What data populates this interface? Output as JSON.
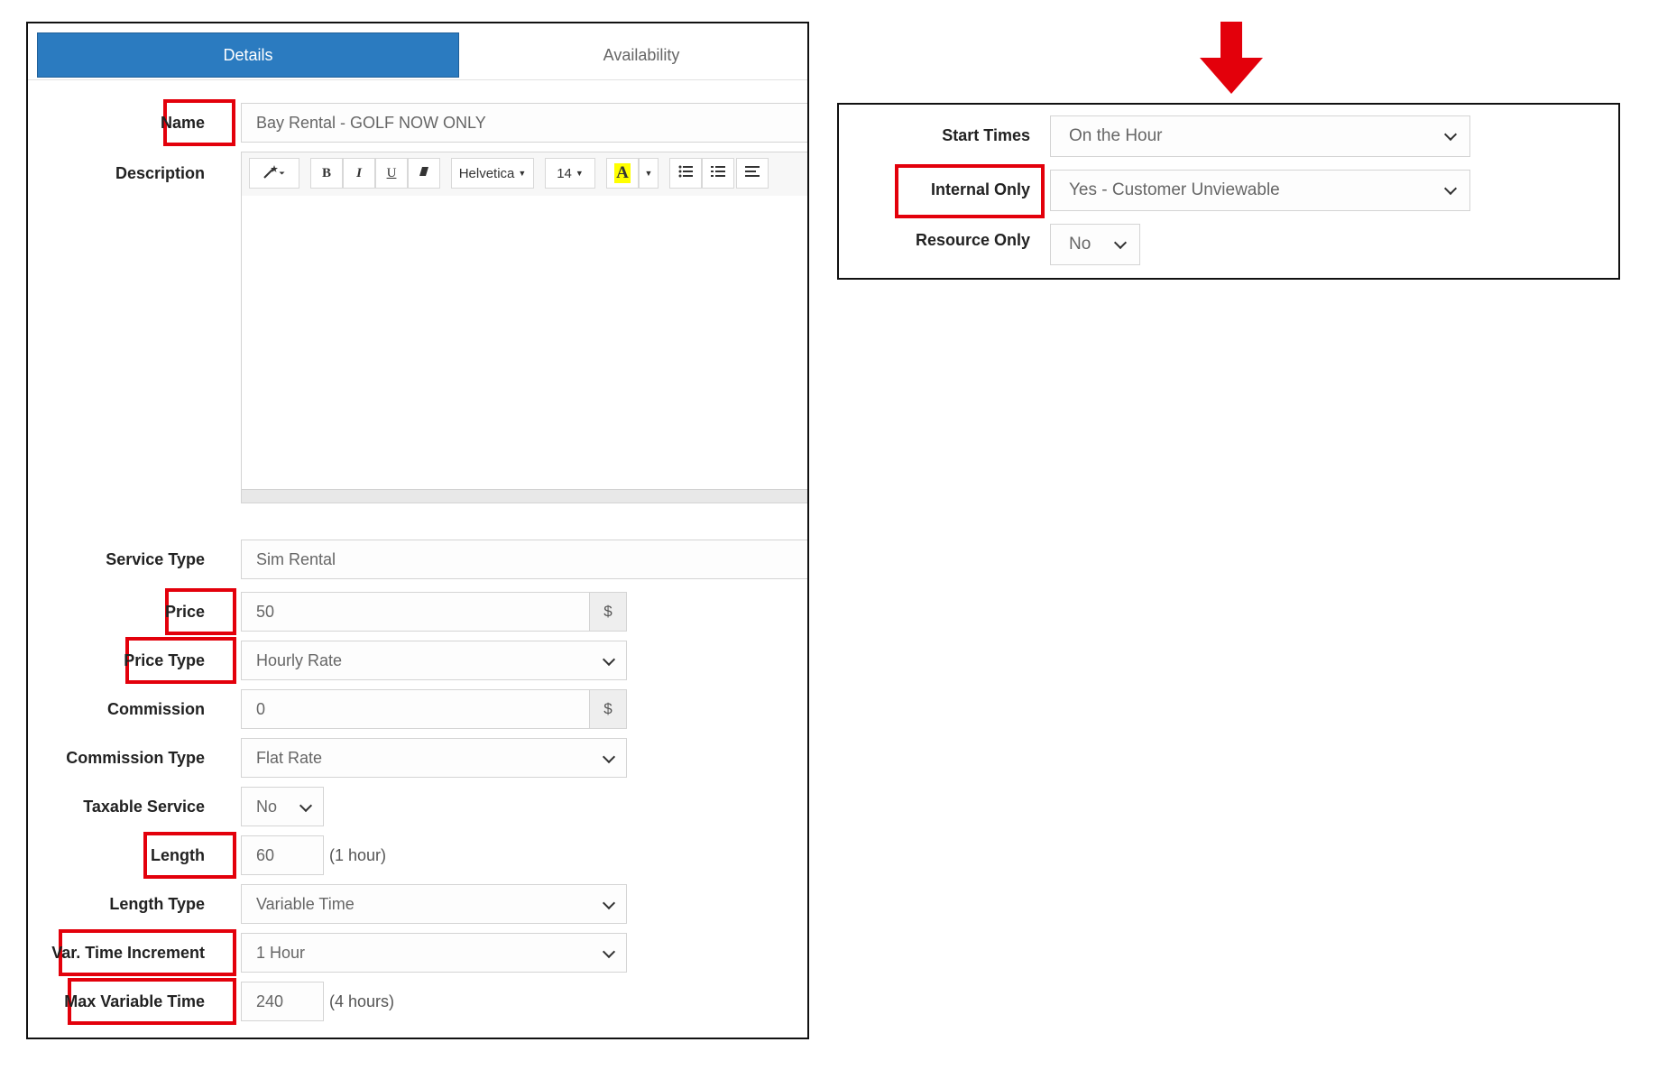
{
  "tabs": {
    "details": "Details",
    "availability": "Availability"
  },
  "form": {
    "name": {
      "label": "Name",
      "value": "Bay Rental - GOLF NOW ONLY"
    },
    "description": {
      "label": "Description"
    },
    "toolbar": {
      "bold": "B",
      "italic": "I",
      "underline": "U",
      "font": "Helvetica",
      "size": "14",
      "color_letter": "A"
    },
    "service_type": {
      "label": "Service Type",
      "value": "Sim Rental"
    },
    "price": {
      "label": "Price",
      "value": "50",
      "addon": "$"
    },
    "price_type": {
      "label": "Price Type",
      "value": "Hourly Rate"
    },
    "commission": {
      "label": "Commission",
      "value": "0",
      "addon": "$"
    },
    "commission_type": {
      "label": "Commission Type",
      "value": "Flat Rate"
    },
    "taxable_service": {
      "label": "Taxable Service",
      "value": "No"
    },
    "length": {
      "label": "Length",
      "value": "60",
      "note": "(1 hour)"
    },
    "length_type": {
      "label": "Length Type",
      "value": "Variable Time"
    },
    "var_time_increment": {
      "label": "Var. Time Increment",
      "value": "1 Hour"
    },
    "max_variable_time": {
      "label": "Max Variable Time",
      "value": "240",
      "note": "(4 hours)"
    }
  },
  "right": {
    "start_times": {
      "label": "Start Times",
      "value": "On the Hour"
    },
    "internal_only": {
      "label": "Internal Only",
      "value": "Yes - Customer Unviewable"
    },
    "resource_only": {
      "label": "Resource Only",
      "value": "No"
    }
  },
  "colors": {
    "highlight": "#e3000b",
    "tab_active": "#2b7bc0",
    "arrow": "#e3000b"
  },
  "icons": [
    "magic-wand-icon",
    "eraser-icon",
    "bullet-list-icon",
    "numbered-list-icon",
    "align-icon",
    "down-arrow-icon"
  ]
}
